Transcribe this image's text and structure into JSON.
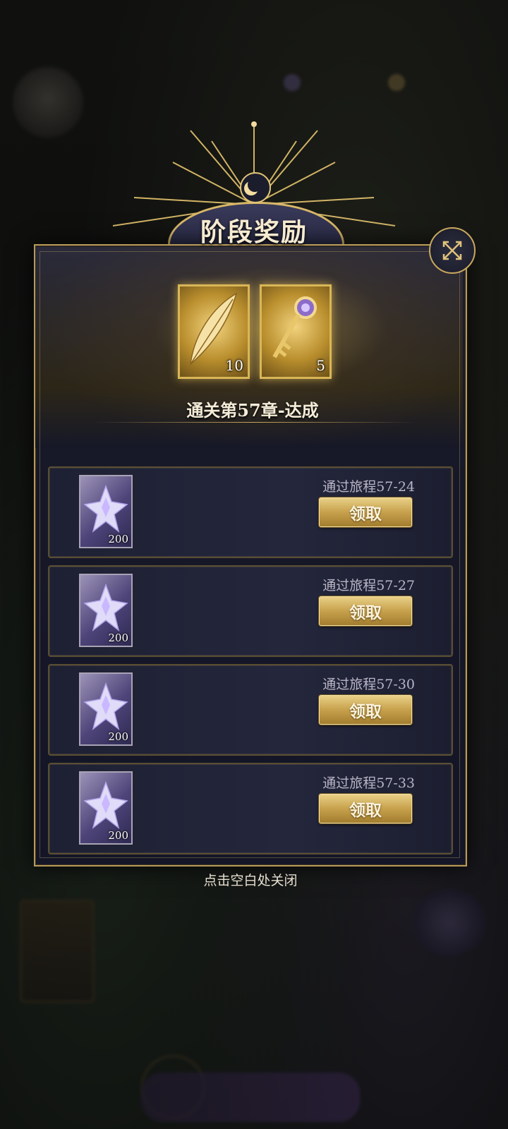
{
  "dialog": {
    "title": "阶段奖励",
    "achievement_text": "通关第57章-达成",
    "footer_hint": "点击空白处关闭",
    "top_rewards": [
      {
        "icon": "feather-icon",
        "count": "10"
      },
      {
        "icon": "key-icon",
        "count": "5"
      }
    ],
    "rows": [
      {
        "label": "通过旅程57-24",
        "reward_count": "200",
        "button": "领取"
      },
      {
        "label": "通过旅程57-27",
        "reward_count": "200",
        "button": "领取"
      },
      {
        "label": "通过旅程57-30",
        "reward_count": "200",
        "button": "领取"
      },
      {
        "label": "通过旅程57-33",
        "reward_count": "200",
        "button": "领取"
      }
    ]
  },
  "colors": {
    "accent_gold": "#d8b768",
    "panel_bg": "#161828",
    "button_gold": "#c7a14c"
  }
}
